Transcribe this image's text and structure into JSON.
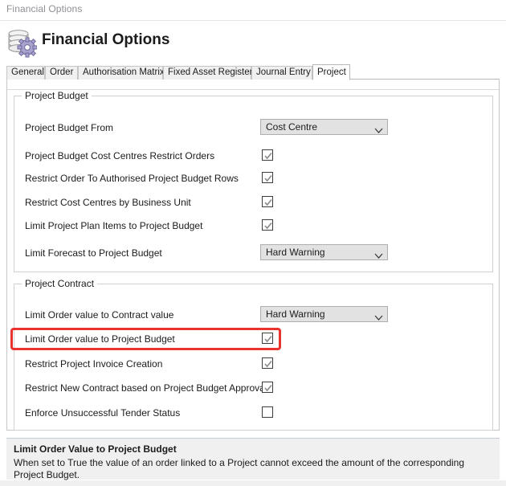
{
  "window": {
    "caption": "Financial Options"
  },
  "header": {
    "title": "Financial Options",
    "icon": "database-gear-icon"
  },
  "tabs": [
    {
      "label": "General",
      "active": false
    },
    {
      "label": "Order",
      "active": false
    },
    {
      "label": "Authorisation Matrix",
      "active": false
    },
    {
      "label": "Fixed Asset Register",
      "active": false
    },
    {
      "label": "Journal Entry",
      "active": false
    },
    {
      "label": "Project",
      "active": true
    }
  ],
  "groups": [
    {
      "legend": "Project Budget",
      "rows": [
        {
          "label": "Project Budget From",
          "control": "combo",
          "value": "Cost Centre"
        },
        {
          "label": "Project Budget Cost Centres Restrict Orders",
          "control": "checkbox",
          "checked": true
        },
        {
          "label": "Restrict Order To Authorised Project Budget Rows",
          "control": "checkbox",
          "checked": true
        },
        {
          "label": "Restrict Cost Centres by Business Unit",
          "control": "checkbox",
          "checked": true
        },
        {
          "label": "Limit Project Plan Items to Project Budget",
          "control": "checkbox",
          "checked": true
        },
        {
          "label": "Limit Forecast to Project Budget",
          "control": "combo",
          "value": "Hard Warning"
        }
      ]
    },
    {
      "legend": "Project Contract",
      "rows": [
        {
          "label": "Limit Order value to Contract value",
          "control": "combo",
          "value": "Hard Warning"
        },
        {
          "label": "Limit Order value to Project Budget",
          "control": "checkbox",
          "checked": true,
          "highlighted": true
        },
        {
          "label": "Restrict Project Invoice Creation",
          "control": "checkbox",
          "checked": true
        },
        {
          "label": "Restrict New Contract based on Project Budget Approval",
          "control": "checkbox",
          "checked": true
        },
        {
          "label": "Enforce Unsuccessful Tender Status",
          "control": "checkbox",
          "checked": false
        }
      ]
    }
  ],
  "help": {
    "title": "Limit Order Value to Project Budget",
    "body": "When set to True the value of an order linked to a Project cannot exceed the amount of the corresponding Project Budget."
  },
  "colors": {
    "highlight": "#e8332f",
    "combo_background": "#e2e2e2",
    "help_background": "#f0f0f0"
  }
}
